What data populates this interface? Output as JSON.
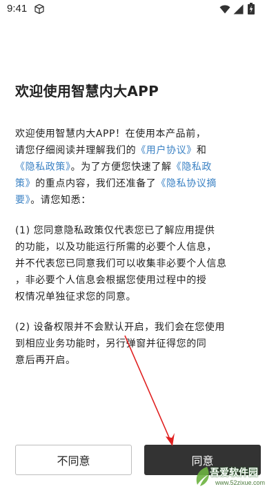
{
  "status_bar": {
    "time": "9:41"
  },
  "dialog": {
    "title": "欢迎使用智慧内大APP",
    "paragraphs": {
      "intro_lines": [
        {
          "segments": [
            {
              "text": "欢迎使用智慧内大APP！在使用本产品前，",
              "link": false
            }
          ]
        },
        {
          "segments": [
            {
              "text": "请您仔细阅读并理解我们的",
              "link": false
            },
            {
              "text": "《用户协议》",
              "link": true
            },
            {
              "text": "和",
              "link": false
            }
          ]
        },
        {
          "segments": [
            {
              "text": "《隐私政策》",
              "link": true
            },
            {
              "text": "。为了方便您快速了解",
              "link": false
            },
            {
              "text": "《隐私政",
              "link": true
            }
          ]
        },
        {
          "segments": [
            {
              "text": "策》",
              "link": true
            },
            {
              "text": "的重点内容，我们还准备了",
              "link": false
            },
            {
              "text": "《隐私协议摘",
              "link": true
            }
          ]
        },
        {
          "segments": [
            {
              "text": "要》",
              "link": true
            },
            {
              "text": "。请您知悉：",
              "link": false
            }
          ]
        }
      ],
      "item1_lines": [
        "(1)  您同意隐私政策仅代表您已了解应用提供",
        "的功能，以及功能运行所需的必要个人信息，",
        "并不代表您已同意我们可以收集非必要个人信息",
        "，非必要个人信息会根据您使用过程中的授",
        "权情况单独征求您的同意。"
      ],
      "item2_lines": [
        "(2)  设备权限并不会默认开启，我们会在您使用",
        "到相应业务功能时，另行弹窗并征得您的同",
        "意后再开启。"
      ]
    }
  },
  "buttons": {
    "disagree": "不同意",
    "agree": "同意"
  },
  "watermark": {
    "main": "吾爱软件园",
    "sub": "www.52zixue.com"
  },
  "colors": {
    "link": "#3b82c4",
    "agree_bg": "#333333",
    "annotation": "#e02020"
  }
}
